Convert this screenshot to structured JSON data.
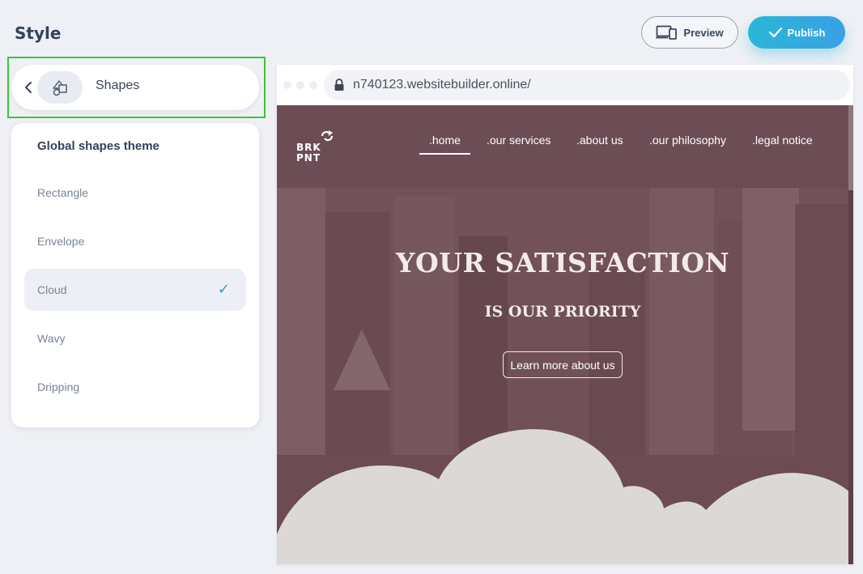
{
  "header": {
    "title": "Style",
    "preview_label": "Preview",
    "publish_label": "Publish"
  },
  "shapes_panel": {
    "title": "Shapes",
    "heading": "Global shapes theme",
    "options": [
      {
        "label": "Rectangle",
        "selected": false
      },
      {
        "label": "Envelope",
        "selected": false
      },
      {
        "label": "Cloud",
        "selected": true
      },
      {
        "label": "Wavy",
        "selected": false
      },
      {
        "label": "Dripping",
        "selected": false
      }
    ]
  },
  "preview": {
    "url": "n740123.websitebuilder.online/",
    "site": {
      "logo_line1": "BRK",
      "logo_line2": "PNT",
      "nav": [
        ".home",
        ".our services",
        ".about us",
        ".our philosophy",
        ".legal notice"
      ],
      "active_nav": ".home",
      "hero_title": "YOUR SATISFACTION",
      "hero_subtitle": "IS OUR PRIORITY",
      "hero_button": "Learn more about us"
    }
  },
  "colors": {
    "accent": "#2f98d8",
    "publish_gradient_start": "#29b7d6",
    "publish_gradient_end": "#3aa0e6",
    "highlight_border": "#3cc43a",
    "site_background": "#6e4c55",
    "cloud_fill": "#ddd8d8"
  },
  "icons": {
    "back": "chevron-left-icon",
    "shapes": "shapes-icon",
    "preview": "devices-icon",
    "publish": "checkmark-icon",
    "lock": "lock-icon",
    "selected": "checkmark-icon"
  }
}
